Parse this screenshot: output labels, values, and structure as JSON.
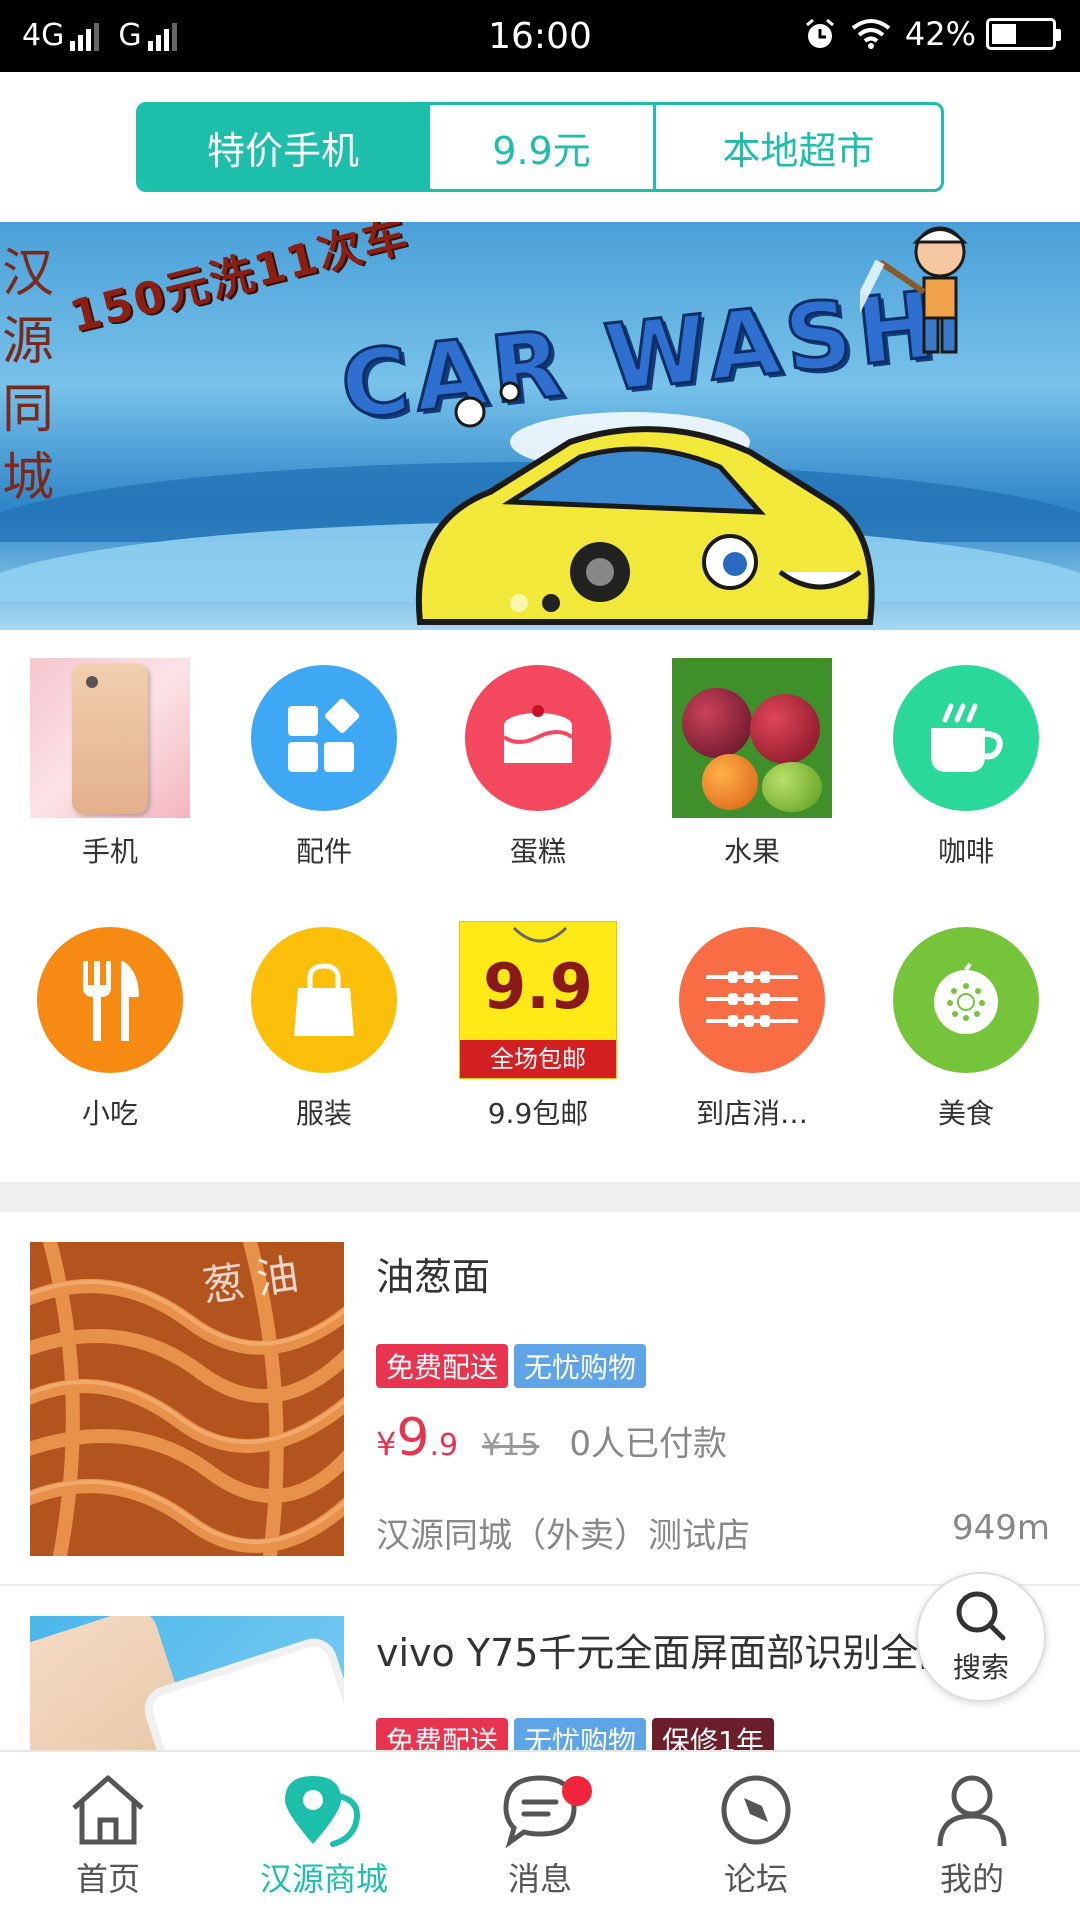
{
  "status_bar": {
    "network1": "4G",
    "network2": "G",
    "time": "16:00",
    "battery": "42%",
    "battery_level": 0.42
  },
  "segmented_tabs": [
    {
      "label": "特价手机",
      "active": true
    },
    {
      "label": "9.9元",
      "active": false
    },
    {
      "label": "本地超市",
      "active": false
    }
  ],
  "banner": {
    "side_text": "汉源同城",
    "promo_text": "150元洗11次车",
    "title": "CAR WASH",
    "dots_count": 2,
    "active_dot": 2
  },
  "categories": [
    {
      "label": "手机",
      "icon": "phone-photo"
    },
    {
      "label": "配件",
      "icon": "apps-icon",
      "color": "#3fa8f4"
    },
    {
      "label": "蛋糕",
      "icon": "cake-icon",
      "color": "#f3485e"
    },
    {
      "label": "水果",
      "icon": "fruit-photo"
    },
    {
      "label": "咖啡",
      "icon": "coffee-icon",
      "color": "#2ad99a"
    },
    {
      "label": "小吃",
      "icon": "fork-knife-icon",
      "color": "#f68a12"
    },
    {
      "label": "服装",
      "icon": "shopping-bag-icon",
      "color": "#fcc00a"
    },
    {
      "label": "9.9包邮",
      "icon": "price-tag-banner",
      "banner_price": "9.9",
      "banner_sub": "全场包邮"
    },
    {
      "label": "到店消…",
      "icon": "skewer-icon",
      "color": "#f96d45"
    },
    {
      "label": "美食",
      "icon": "kiwi-icon",
      "color": "#76c43a"
    }
  ],
  "products": [
    {
      "name": "油葱面",
      "tags": [
        {
          "text": "免费配送",
          "color": "#e8344e"
        },
        {
          "text": "无忧购物",
          "color": "#5fa4e6"
        }
      ],
      "price_currency": "¥",
      "price_int": "9",
      "price_dec": ".9",
      "original_price": "¥15",
      "sold": "0人已付款",
      "shop": "汉源同城（外卖）测试店",
      "distance": "949m",
      "thumb_text": "葱油"
    },
    {
      "name": "vivo Y75千元全面屏面部识别全网",
      "tags": [
        {
          "text": "免费配送",
          "color": "#e8344e"
        },
        {
          "text": "无忧购物",
          "color": "#5fa4e6"
        },
        {
          "text": "保修1年",
          "color": "#6b1f2a"
        }
      ]
    }
  ],
  "fab": {
    "label": "搜索",
    "icon": "search-icon"
  },
  "bottom_nav": [
    {
      "label": "首页",
      "icon": "home-icon",
      "active": false
    },
    {
      "label": "汉源商城",
      "icon": "location-pin-icon",
      "active": true
    },
    {
      "label": "消息",
      "icon": "chat-icon",
      "active": false,
      "badge": true
    },
    {
      "label": "论坛",
      "icon": "compass-icon",
      "active": false
    },
    {
      "label": "我的",
      "icon": "user-icon",
      "active": false
    }
  ],
  "colors": {
    "accent": "#1dbfaa",
    "price": "#e8344e"
  }
}
